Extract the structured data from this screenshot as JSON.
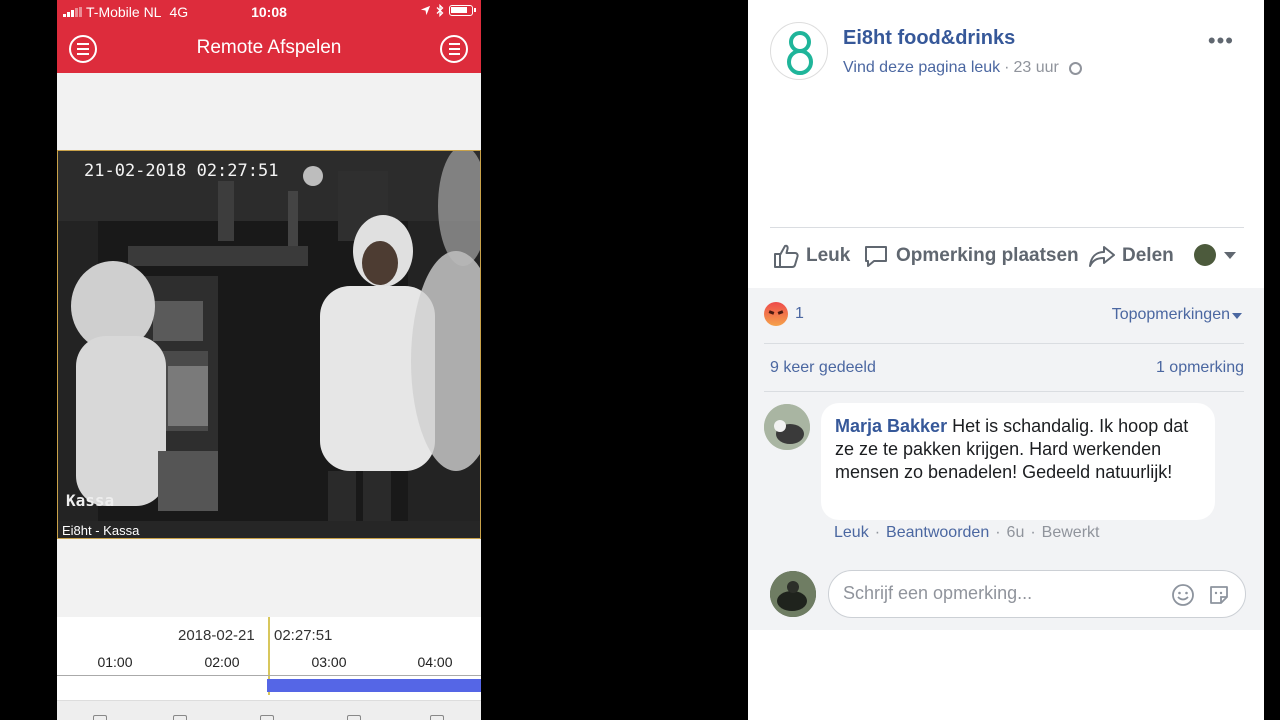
{
  "phone": {
    "status": {
      "carrier": "T-Mobile NL",
      "network": "4G",
      "time": "10:08"
    },
    "app_title": "Remote Afspelen",
    "video": {
      "osd_timestamp": "21-02-2018 02:27:51",
      "osd_camera": "Kassa",
      "caption": "Ei8ht - Kassa"
    },
    "timeline": {
      "date": "2018-02-21",
      "time": "02:27:51",
      "hours": [
        "01:00",
        "02:00",
        "03:00",
        "04:00"
      ]
    }
  },
  "post": {
    "page_name": "Ei8ht food&drinks",
    "like_page": "Vind deze pagina leuk",
    "separator": "·",
    "time_ago": "23 uur",
    "more": "•••",
    "actions": {
      "like": "Leuk",
      "comment": "Opmerking plaatsen",
      "share": "Delen"
    },
    "reactions_count": "1",
    "sort_label": "Topopmerkingen",
    "shares": "9 keer gedeeld",
    "comments_count": "1 opmerking",
    "comment": {
      "author": "Marja Bakker",
      "text": "Het is schandalig. Ik hoop dat ze ze te pakken krijgen. Hard werkenden mensen zo benadelen! Gedeeld natuurlijk!",
      "like": "Leuk",
      "reply": "Beantwoorden",
      "age": "6u",
      "edited": "Bewerkt"
    },
    "write_placeholder": "Schrijf een opmerking..."
  },
  "colors": {
    "app_red": "#dd2c3c",
    "fb_blue": "#365899",
    "fb_link": "#4b67a1",
    "fb_gray": "#606770",
    "timeline_bar": "#5566e6",
    "logo_teal": "#1fb59a"
  },
  "icons": [
    "menu-icon",
    "list-icon",
    "location-icon",
    "bluetooth-icon",
    "battery-icon",
    "thumbs-up-icon",
    "comment-icon",
    "share-icon",
    "globe-icon",
    "angry-reaction-icon",
    "smile-icon",
    "sticker-icon"
  ]
}
